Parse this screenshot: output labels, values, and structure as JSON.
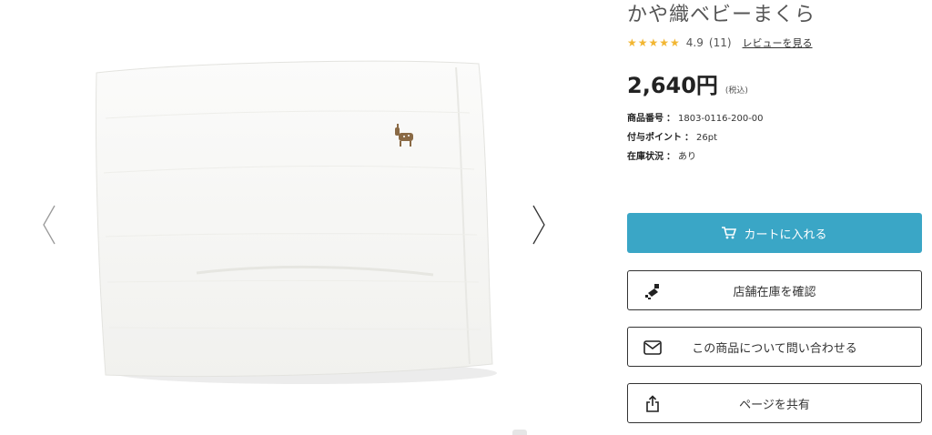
{
  "product": {
    "title": "かや織ベビーまくら",
    "rating": {
      "stars": "★★★★★",
      "score": "4.9",
      "count": "(11)",
      "review_link": "レビューを見る"
    },
    "price": "2,640円",
    "tax_note": "(税込)",
    "specs": [
      {
        "label": "商品番号",
        "value": "1803-0116-200-00"
      },
      {
        "label": "付与ポイント",
        "value": "26pt"
      },
      {
        "label": "在庫状況",
        "value": "あり"
      }
    ],
    "spec_separator": "："
  },
  "buttons": {
    "cart": "カートに入れる",
    "store_stock": "店舗在庫を確認",
    "inquiry": "この商品について問い合わせる",
    "share": "ページを共有"
  },
  "icons": {
    "prev": "chevron-left-icon",
    "next": "chevron-right-icon",
    "cart": "cart-icon",
    "store": "store-stock-icon",
    "mail": "mail-icon",
    "share": "share-icon"
  },
  "colors": {
    "accent": "#3aa6c6",
    "star": "#f2b632",
    "text": "#333333"
  }
}
